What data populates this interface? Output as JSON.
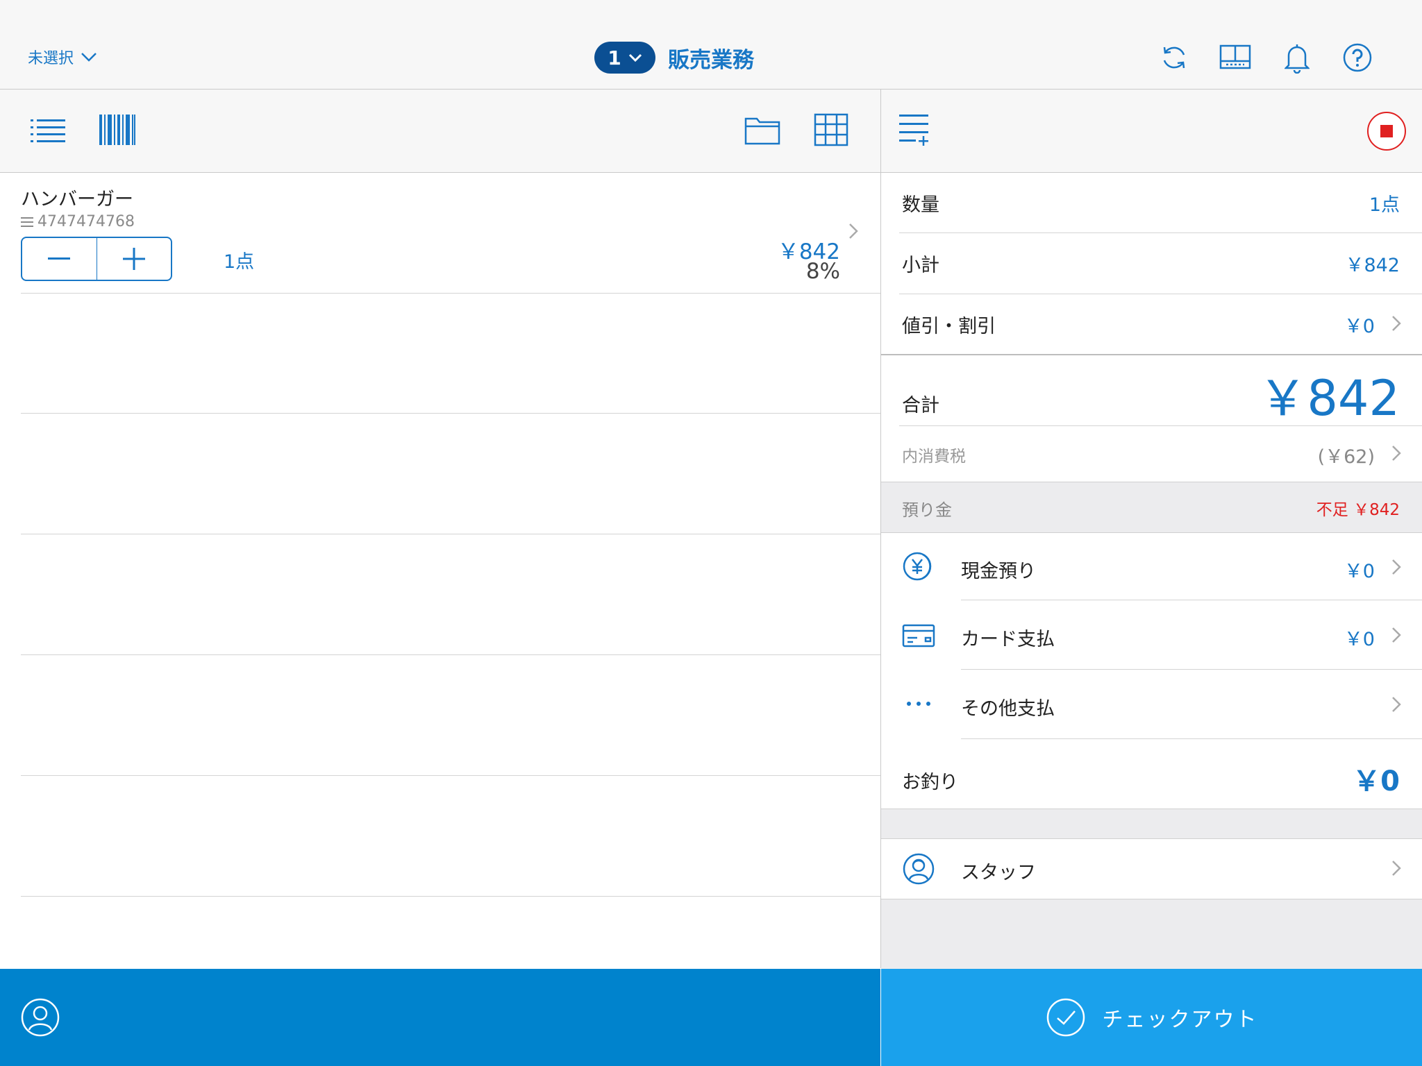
{
  "colors": {
    "accent": "#1877c6",
    "navy": "#0b4f93",
    "alert": "#e02020",
    "bottom_left": "#0083cd",
    "bottom_right": "#1aa1ec"
  },
  "header": {
    "store_select_label": "未選択",
    "register_number": "1",
    "mode_title": "販売業務",
    "icons": [
      "refresh-icon",
      "customer-display-icon",
      "bell-icon",
      "help-icon"
    ]
  },
  "left_toolbar": {
    "icons": [
      "list-view-icon",
      "barcode-icon",
      "folder-icon",
      "grid-view-icon"
    ]
  },
  "cart": {
    "items": [
      {
        "name": "ハンバーガー",
        "code": "4747474768",
        "quantity": "1点",
        "price": "￥842",
        "tax_rate": "8%"
      }
    ]
  },
  "right_toolbar": {
    "icons": [
      "add-line-icon",
      "stop-icon"
    ]
  },
  "summary": {
    "quantity_label": "数量",
    "quantity_value": "1点",
    "subtotal_label": "小計",
    "subtotal_value": "￥842",
    "discount_label": "値引・割引",
    "discount_value": "￥0",
    "total_label": "合計",
    "total_value": "￥842",
    "tax_label": "内消費税",
    "tax_value": "(￥62)",
    "deposit_label": "預り金",
    "deposit_status": "不足 ￥842",
    "payments": [
      {
        "label": "現金預り",
        "value": "￥0",
        "icon": "yen-coin-icon"
      },
      {
        "label": "カード支払",
        "value": "￥0",
        "icon": "credit-card-icon"
      },
      {
        "label": "その他支払",
        "value": "",
        "icon": "more-dots-icon"
      }
    ],
    "change_label": "お釣り",
    "change_value": "￥0",
    "staff_label": "スタッフ"
  },
  "footer": {
    "customer_icon": "customer-icon",
    "checkout_label": "チェックアウト"
  }
}
